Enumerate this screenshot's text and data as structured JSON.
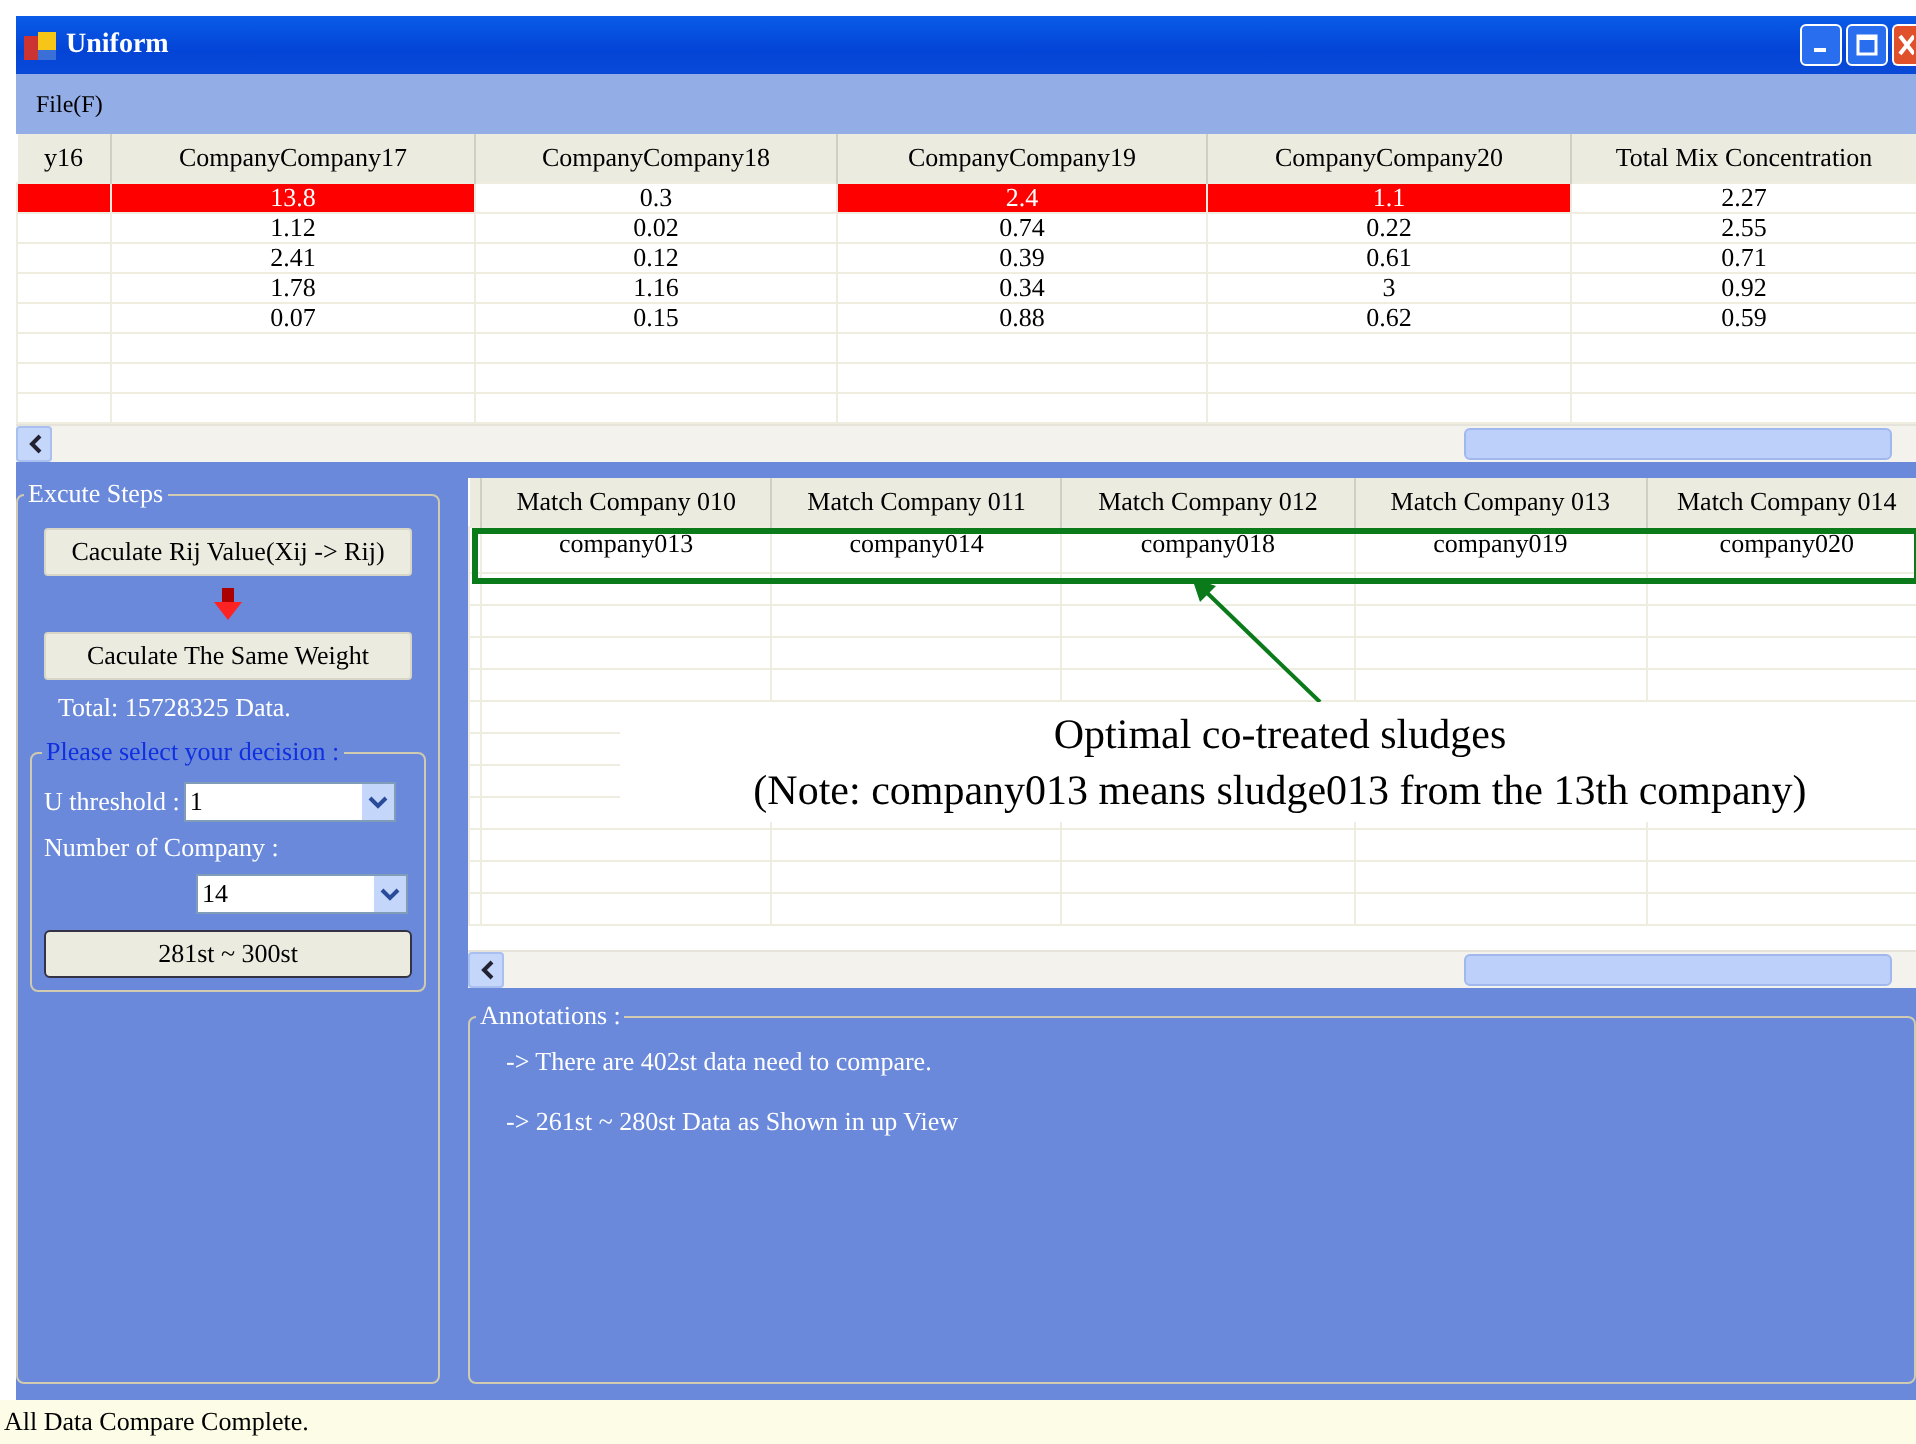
{
  "window": {
    "title": "Uniform"
  },
  "menu": [
    "File(F)"
  ],
  "top_table": {
    "columns": [
      "y16",
      "CompanyCompany17",
      "CompanyCompany18",
      "CompanyCompany19",
      "CompanyCompany20",
      "Total Mix Concentration"
    ],
    "rows": [
      {
        "cells": [
          {
            "highlighted": true
          },
          {
            "text": "13.8",
            "highlighted": true
          },
          {
            "text": "0.3",
            "highlighted": false
          },
          {
            "text": "2.4",
            "highlighted": true
          },
          {
            "text": "1.1",
            "highlighted": true
          },
          {
            "text": "2.27",
            "highlighted": false
          }
        ]
      },
      {
        "cells": [
          {
            "highlighted": false
          },
          {
            "text": "1.12",
            "highlighted": false
          },
          {
            "text": "0.02",
            "highlighted": false
          },
          {
            "text": "0.74",
            "highlighted": false
          },
          {
            "text": "0.22",
            "highlighted": false
          },
          {
            "text": "2.55",
            "highlighted": false
          }
        ]
      },
      {
        "cells": [
          {
            "highlighted": false
          },
          {
            "text": "2.41",
            "highlighted": false
          },
          {
            "text": "0.12",
            "highlighted": false
          },
          {
            "text": "0.39",
            "highlighted": false
          },
          {
            "text": "0.61",
            "highlighted": false
          },
          {
            "text": "0.71",
            "highlighted": false
          }
        ]
      },
      {
        "cells": [
          {
            "highlighted": false
          },
          {
            "text": "1.78",
            "highlighted": false
          },
          {
            "text": "1.16",
            "highlighted": false
          },
          {
            "text": "0.34",
            "highlighted": false
          },
          {
            "text": "3",
            "highlighted": false
          },
          {
            "text": "0.92",
            "highlighted": false
          }
        ]
      },
      {
        "cells": [
          {
            "highlighted": false
          },
          {
            "text": "0.07",
            "highlighted": false
          },
          {
            "text": "0.15",
            "highlighted": false
          },
          {
            "text": "0.88",
            "highlighted": false
          },
          {
            "text": "0.62",
            "highlighted": false
          },
          {
            "text": "0.59",
            "highlighted": false
          }
        ]
      }
    ]
  },
  "steps": {
    "title": "Excute Steps",
    "buttons": [
      "Caculate Rij Value(Xij -> Rij)",
      "Caculate The Same Weight"
    ],
    "total": "Total: 15728325 Data.",
    "decision": {
      "title": "Please select your decision :",
      "fields": [
        {
          "kind": "inline",
          "label": "U threshold :",
          "value": "1"
        },
        {
          "kind": "stacked",
          "label": "Number of Company :",
          "value": "14"
        }
      ],
      "button": "281st ~ 300st"
    }
  },
  "match_table": {
    "columns": [
      "Match Company 010",
      "Match Company 011",
      "Match Company 012",
      "Match Company 013",
      "Match Company 014"
    ],
    "rows": [
      {
        "cells": [
          "company013",
          "company014",
          "company018",
          "company019",
          "company020"
        ],
        "selected": true
      }
    ]
  },
  "callout": {
    "lines": [
      "Optimal co-treated sludges",
      "(Note: company013 means sludge013 from the 13th company)"
    ]
  },
  "annotations": {
    "title": "Annotations :",
    "lines": [
      "-> There are 402st data need to compare.",
      "-> 261st ~ 280st Data as Shown in up View"
    ]
  },
  "status_bar": "All Data Compare Complete."
}
